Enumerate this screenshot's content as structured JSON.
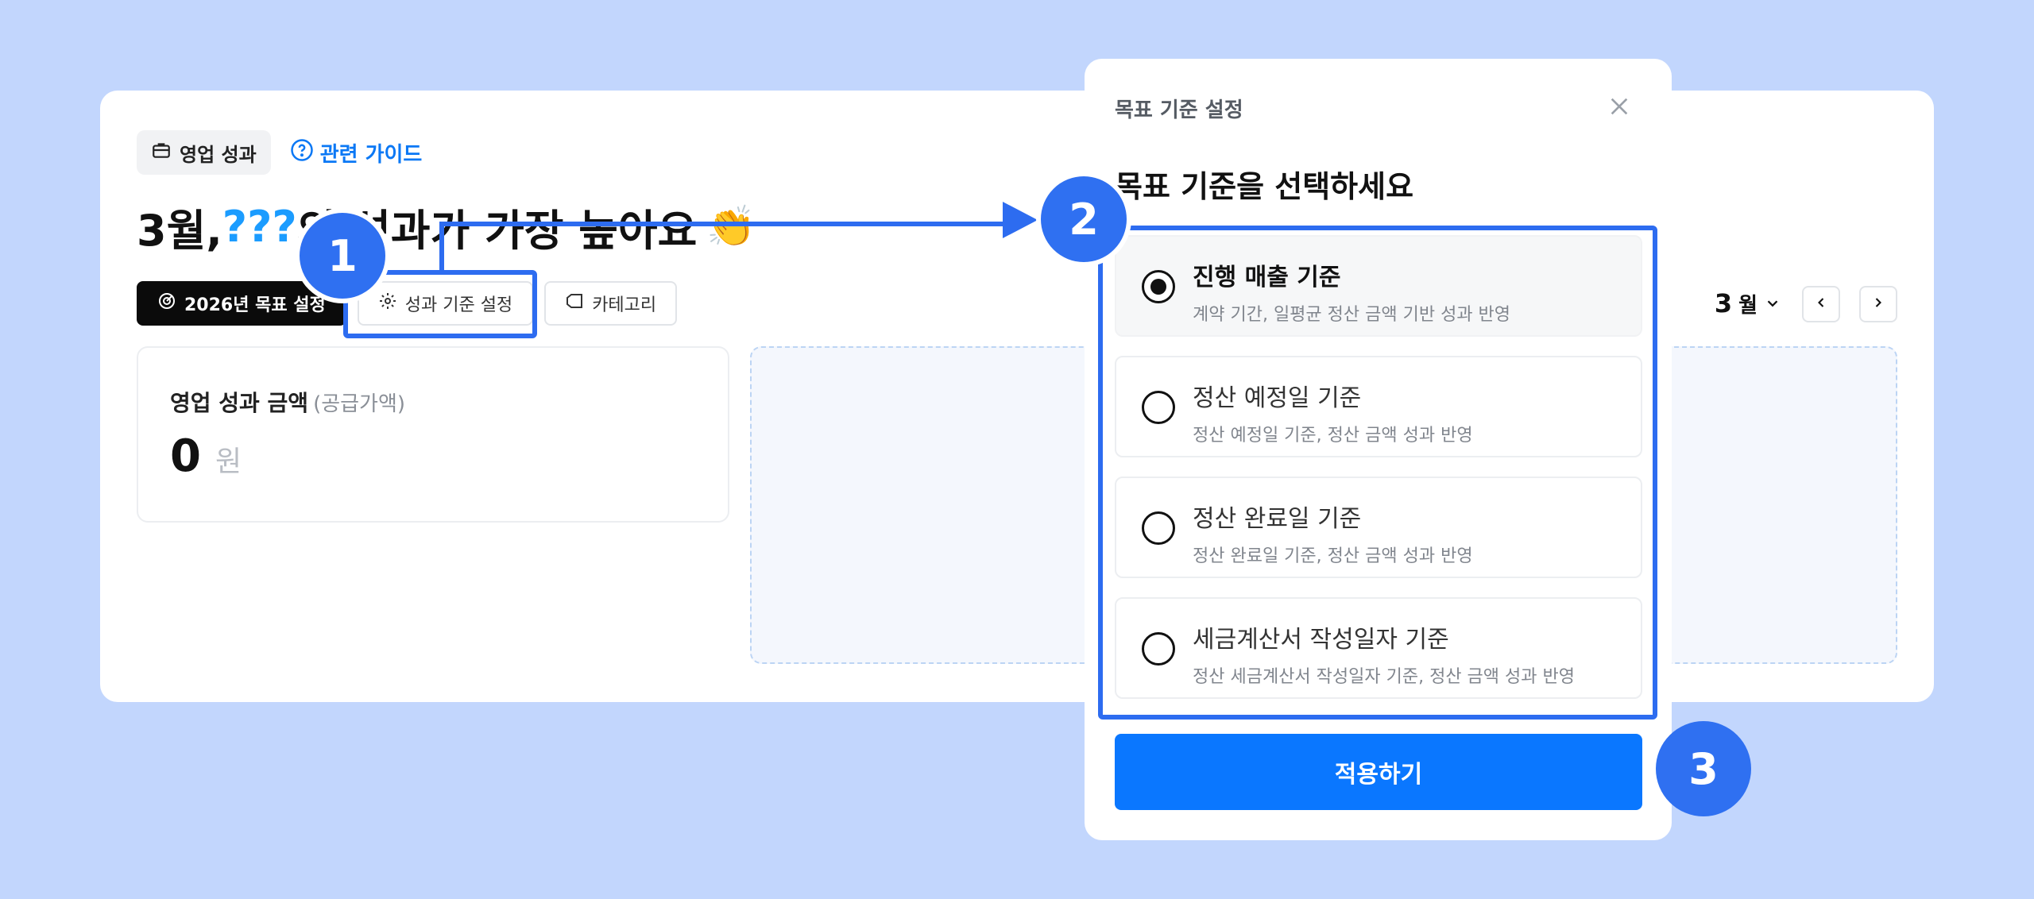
{
  "header": {
    "tab_label": "영업 성과",
    "guide_link": "관련 가이드"
  },
  "headline": {
    "prefix": "3월, ",
    "highlight": "???",
    "suffix": "의 성과가 가장 높아요",
    "emoji": "👏"
  },
  "toolbar": {
    "goal_setting": "2026년 목표 설정",
    "criteria_setting": "성과 기준 설정",
    "category": "카테고리",
    "month_value": "3",
    "month_unit": "월"
  },
  "summary": {
    "label": "영업 성과 금액",
    "sub_label": "(공급가액)",
    "value": "0",
    "unit": "원"
  },
  "modal": {
    "title": "목표 기준 설정",
    "heading": "목표 기준을 선택하세요",
    "options": [
      {
        "title": "진행 매출 기준",
        "desc": "계약 기간, 일평균 정산 금액 기반 성과 반영",
        "selected": true
      },
      {
        "title": "정산 예정일 기준",
        "desc": "정산 예정일 기준, 정산 금액 성과 반영",
        "selected": false
      },
      {
        "title": "정산 완료일 기준",
        "desc": "정산 완료일 기준, 정산 금액 성과 반영",
        "selected": false
      },
      {
        "title": "세금계산서 작성일자 기준",
        "desc": "정산 세금계산서 작성일자 기준, 정산 금액 성과 반영",
        "selected": false
      }
    ],
    "apply": "적용하기"
  },
  "annotations": {
    "step1": "1",
    "step2": "2",
    "step3": "3"
  },
  "colors": {
    "background": "#c2d6fd",
    "accent": "#2f70f1",
    "primary_button": "#0a77ff",
    "highlight_text": "#1b9cff"
  }
}
